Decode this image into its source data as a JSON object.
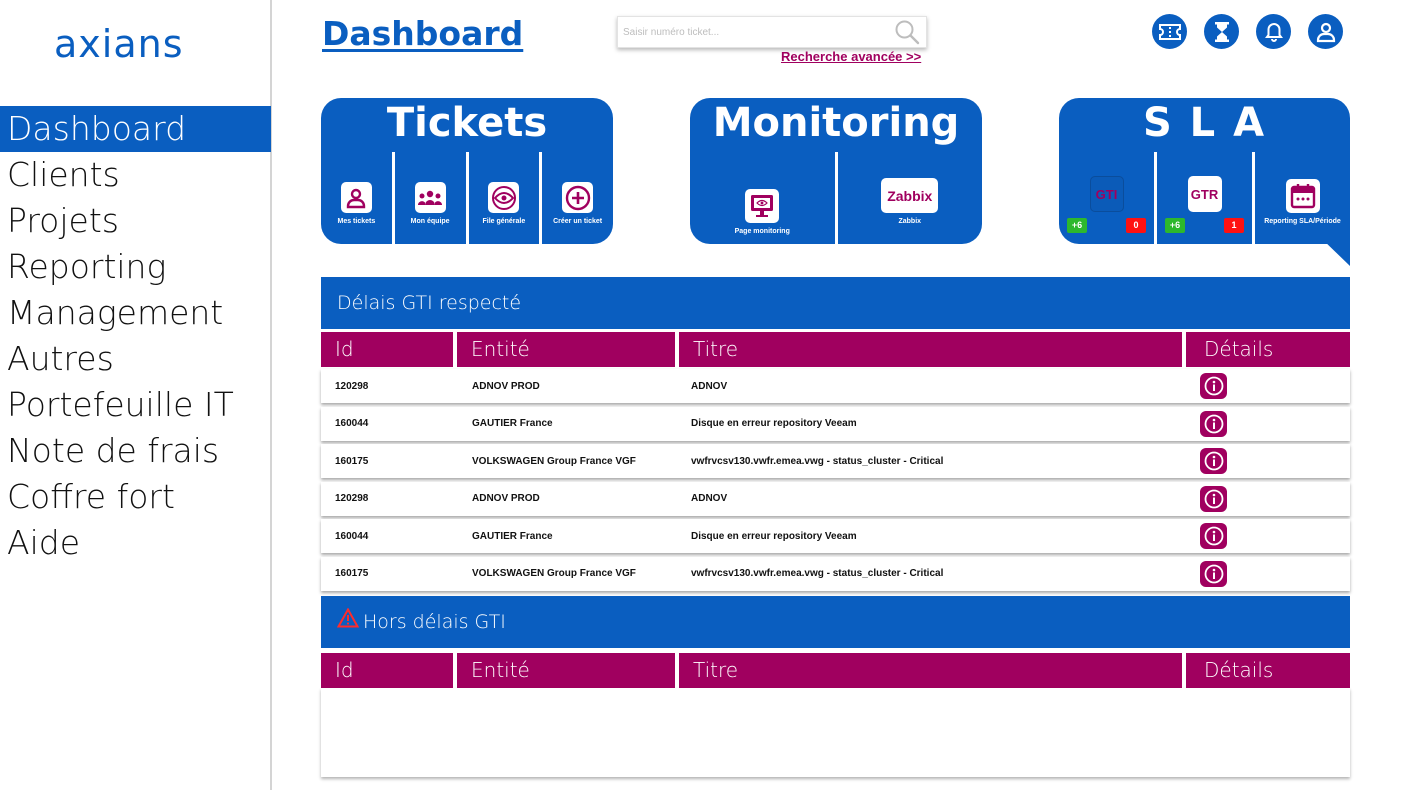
{
  "brand": {
    "logo_text": "axians",
    "primary_color": "#0a5ec0",
    "accent_color": "#a0005f"
  },
  "sidebar": {
    "items": [
      {
        "label": "Dashboard",
        "active": true
      },
      {
        "label": "Clients"
      },
      {
        "label": "Projets"
      },
      {
        "label": "Reporting"
      },
      {
        "label": "Management"
      },
      {
        "label": "Autres"
      },
      {
        "label": "Portefeuille IT"
      },
      {
        "label": "Note de frais"
      },
      {
        "label": "Coffre fort"
      },
      {
        "label": "Aide"
      }
    ]
  },
  "header": {
    "title": "Dashboard",
    "search_placeholder": "Saisir numéro ticket...",
    "advanced_search": "Recherche avancée >>",
    "icons": [
      "ticket-icon",
      "hourglass-icon",
      "bell-icon",
      "user-icon"
    ]
  },
  "cards": {
    "tickets": {
      "title": "Tickets",
      "items": [
        {
          "label": "Mes tickets",
          "icon": "person-icon"
        },
        {
          "label": "Mon équipe",
          "icon": "team-icon"
        },
        {
          "label": "File générale",
          "icon": "eye-icon"
        },
        {
          "label": "Créer un ticket",
          "icon": "plus-circle-icon"
        }
      ]
    },
    "monitoring": {
      "title": "Monitoring",
      "items": [
        {
          "label": "Page monitoring",
          "icon": "monitor-icon"
        },
        {
          "label": "Zabbix",
          "tile_text": "Zabbix"
        }
      ]
    },
    "sla": {
      "title": "S L A",
      "gti": {
        "label": "GTI",
        "ok": "+6",
        "ko": "0"
      },
      "gtr": {
        "label": "GTR",
        "ok": "+6",
        "ko": "1"
      },
      "reporting": {
        "label": "Reporting SLA/Période",
        "icon": "calendar-icon"
      }
    }
  },
  "section_ok": {
    "title": "Délais GTI respecté",
    "columns": {
      "id": "Id",
      "entity": "Entité",
      "title": "Titre",
      "details": "Détails"
    },
    "rows": [
      {
        "id": "120298",
        "entity": "ADNOV PROD",
        "title": "ADNOV"
      },
      {
        "id": "160044",
        "entity": "GAUTIER France",
        "title": "Disque en erreur repository Veeam"
      },
      {
        "id": "160175",
        "entity": "VOLKSWAGEN Group France VGF",
        "title": "vwfrvcsv130.vwfr.emea.vwg - status_cluster - Critical"
      },
      {
        "id": "120298",
        "entity": "ADNOV PROD",
        "title": "ADNOV"
      },
      {
        "id": "160044",
        "entity": "GAUTIER France",
        "title": "Disque en erreur repository Veeam"
      },
      {
        "id": "160175",
        "entity": "VOLKSWAGEN Group France VGF",
        "title": "vwfrvcsv130.vwfr.emea.vwg - status_cluster - Critical"
      }
    ]
  },
  "section_late": {
    "title": "Hors délais GTI",
    "columns": {
      "id": "Id",
      "entity": "Entité",
      "title": "Titre",
      "details": "Détails"
    },
    "rows": []
  }
}
